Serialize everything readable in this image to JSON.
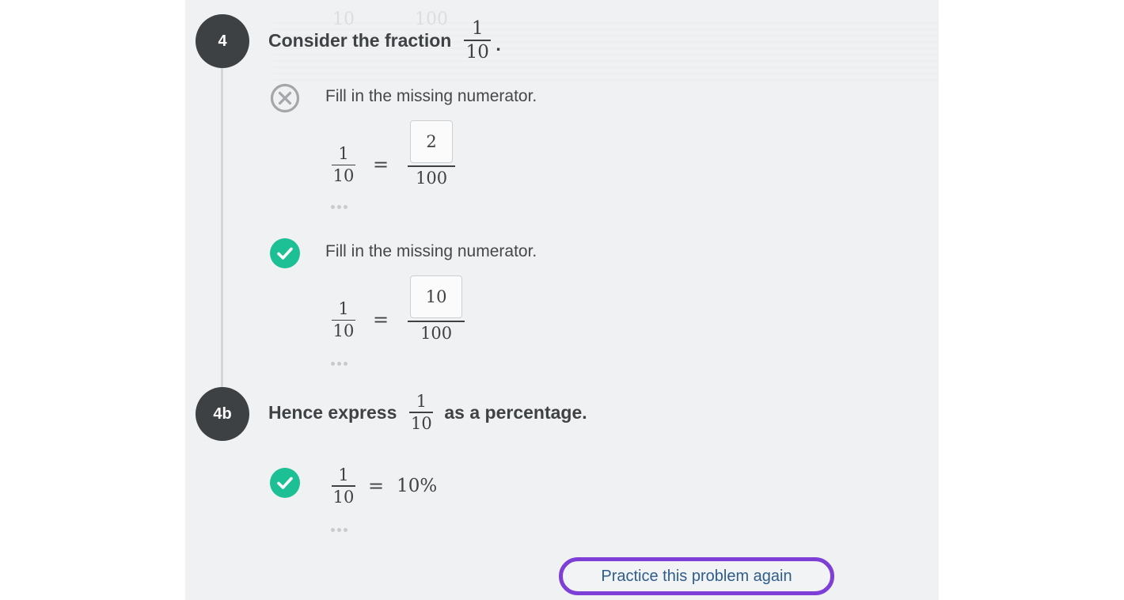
{
  "colors": {
    "panel_bg": "#f0f1f3",
    "step_circle": "#3d4143",
    "correct_green": "#1dbf94",
    "wrong_gray": "#a4a6a9",
    "highlight_purple": "#7d3fd6",
    "link_blue": "#2f5d8a"
  },
  "step4": {
    "label": "4",
    "question_prefix": "Consider the fraction",
    "fraction": {
      "numerator": "1",
      "denominator": "10"
    },
    "question_suffix": ".",
    "attempts": [
      {
        "status": "incorrect",
        "status_icon": "x-circle-icon",
        "instruction": "Fill in the missing numerator.",
        "lhs": {
          "numerator": "1",
          "denominator": "10"
        },
        "equals": "=",
        "answer_value": "2",
        "rhs_denominator": "100"
      },
      {
        "status": "correct",
        "status_icon": "check-circle-icon",
        "instruction": "Fill in the missing numerator.",
        "lhs": {
          "numerator": "1",
          "denominator": "10"
        },
        "equals": "=",
        "answer_value": "10",
        "rhs_denominator": "100"
      }
    ]
  },
  "step4b": {
    "label": "4b",
    "question_prefix": "Hence express",
    "fraction": {
      "numerator": "1",
      "denominator": "10"
    },
    "question_suffix": "as a percentage.",
    "answer": {
      "status": "correct",
      "status_icon": "check-circle-icon",
      "lhs": {
        "numerator": "1",
        "denominator": "10"
      },
      "equals": "=",
      "value": "10%"
    }
  },
  "practice_button": {
    "label": "Practice this problem again"
  },
  "ghost": {
    "left": "10",
    "right": "100"
  }
}
